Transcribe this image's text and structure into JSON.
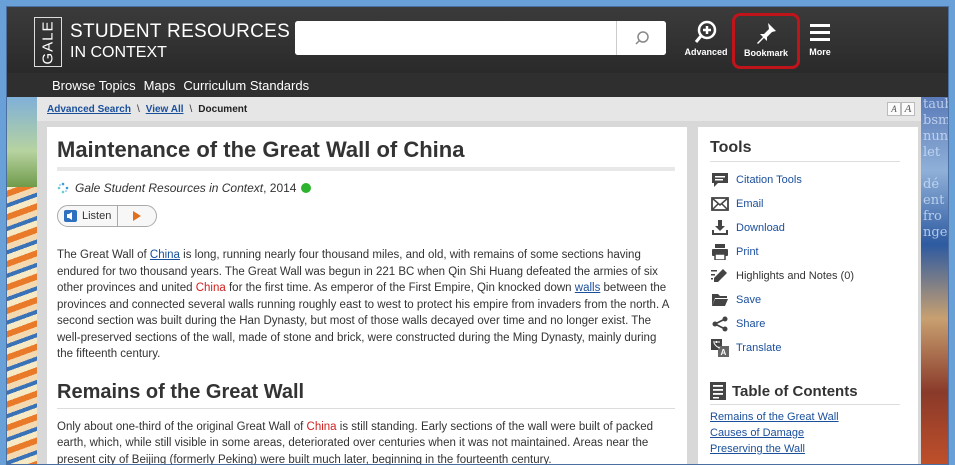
{
  "header": {
    "logo": "GALE",
    "brand_line1": "STUDENT RESOURCES",
    "brand_line2": "IN CONTEXT",
    "search_placeholder": "",
    "advanced_label": "Advanced",
    "bookmark_label": "Bookmark",
    "more_label": "More"
  },
  "nav": {
    "items": [
      "Browse Topics",
      "Maps",
      "Curriculum Standards"
    ]
  },
  "breadcrumb": {
    "advanced_search": "Advanced Search",
    "view_all": "View All",
    "sep": "\\",
    "current": "Document"
  },
  "font_size_controls": [
    "A",
    "A"
  ],
  "article": {
    "title": "Maintenance of the Great Wall of China",
    "source": "Gale Student Resources in Context",
    "year": ", 2014",
    "listen_label": "Listen",
    "p1_a": "The Great Wall of ",
    "p1_link_china": "China",
    "p1_b": " is long, running nearly four thousand miles, and old, with remains of some sections having endured for two thousand years. The Great Wall was begun in 221 BC when Qin Shi Huang defeated the armies of six other provinces and united ",
    "p1_red_china": "China",
    "p1_c": " for the first time. As emperor of the First Empire, Qin knocked down ",
    "p1_link_walls": "walls",
    "p1_d": " between the provinces and connected several walls running roughly east to west to protect his empire from invaders from the north. A second section was built during the Han Dynasty, but most of those walls decayed over time and no longer exist. The well-preserved sections of the wall, made of stone and brick, were constructed during the Ming Dynasty, mainly during the fifteenth century.",
    "h2": "Remains of the Great Wall",
    "p2_a": "Only about one-third of the original Great Wall of ",
    "p2_red_china": "China",
    "p2_b": " is still standing. Early sections of the wall were built of packed earth, which, while still visible in some areas, deteriorated over centuries when it was not maintained. Areas near the present city of Beijing (formerly Peking) were built much later, beginning in the fourteenth century."
  },
  "tools": {
    "title": "Tools",
    "items": [
      {
        "label": "Citation Tools",
        "icon": "speech-bubble-icon"
      },
      {
        "label": "Email",
        "icon": "envelope-icon"
      },
      {
        "label": "Download",
        "icon": "download-icon"
      },
      {
        "label": "Print",
        "icon": "printer-icon"
      },
      {
        "label": "Highlights and Notes (0)",
        "icon": "pencil-icon"
      },
      {
        "label": "Save",
        "icon": "folder-icon"
      },
      {
        "label": "Share",
        "icon": "share-icon"
      },
      {
        "label": "Translate",
        "icon": "translate-icon"
      }
    ],
    "toc_title": "Table of Contents",
    "toc_items": [
      "Remains of the Great Wall",
      "Causes of Damage",
      "Preserving the Wall"
    ]
  },
  "side_text": "taub\nbsm\nnun\nlet\n\ndé\nent\nfro\nnge"
}
